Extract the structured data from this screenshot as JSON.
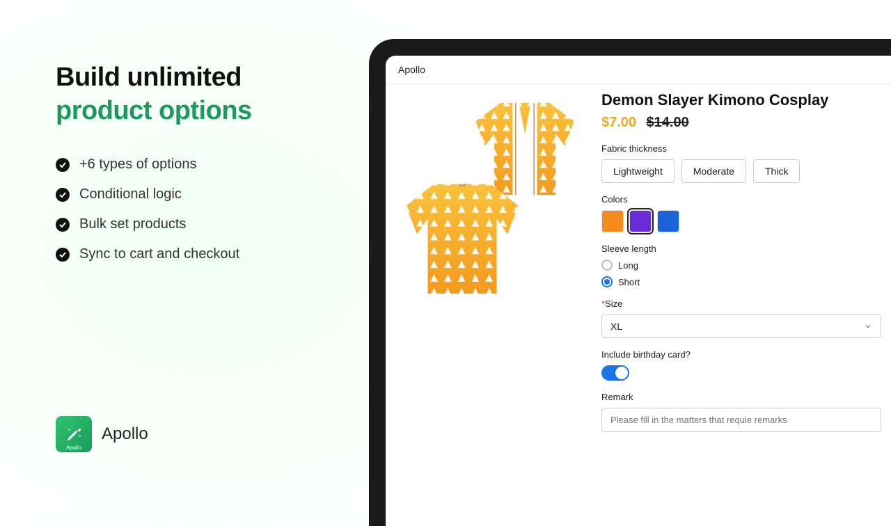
{
  "headline": {
    "line1": "Build unlimited",
    "line2": "product options"
  },
  "features": [
    "+6 types of options",
    "Conditional logic",
    "Bulk set products",
    "Sync to cart and checkout"
  ],
  "brand": {
    "name": "Apollo",
    "icon_sub": "Apollo"
  },
  "app": {
    "topbar_title": "Apollo"
  },
  "product": {
    "title": "Demon Slayer Kimono Cosplay",
    "price": "$7.00",
    "old_price": "$14.00",
    "fabric": {
      "label": "Fabric thickness",
      "options": [
        "Lightweight",
        "Moderate",
        "Thick"
      ]
    },
    "colors": {
      "label": "Colors",
      "values": [
        "#f58a1f",
        "#6a2cd8",
        "#1a63d8"
      ],
      "selected_index": 1
    },
    "sleeve": {
      "label": "Sleeve length",
      "options": [
        "Long",
        "Short"
      ],
      "selected": "Short"
    },
    "size": {
      "label": "Size",
      "required": true,
      "value": "XL"
    },
    "birthday": {
      "label": "Include birthday card?",
      "on": true
    },
    "remark": {
      "label": "Remark",
      "placeholder": "Please fill in the matters that requie remarks"
    }
  }
}
